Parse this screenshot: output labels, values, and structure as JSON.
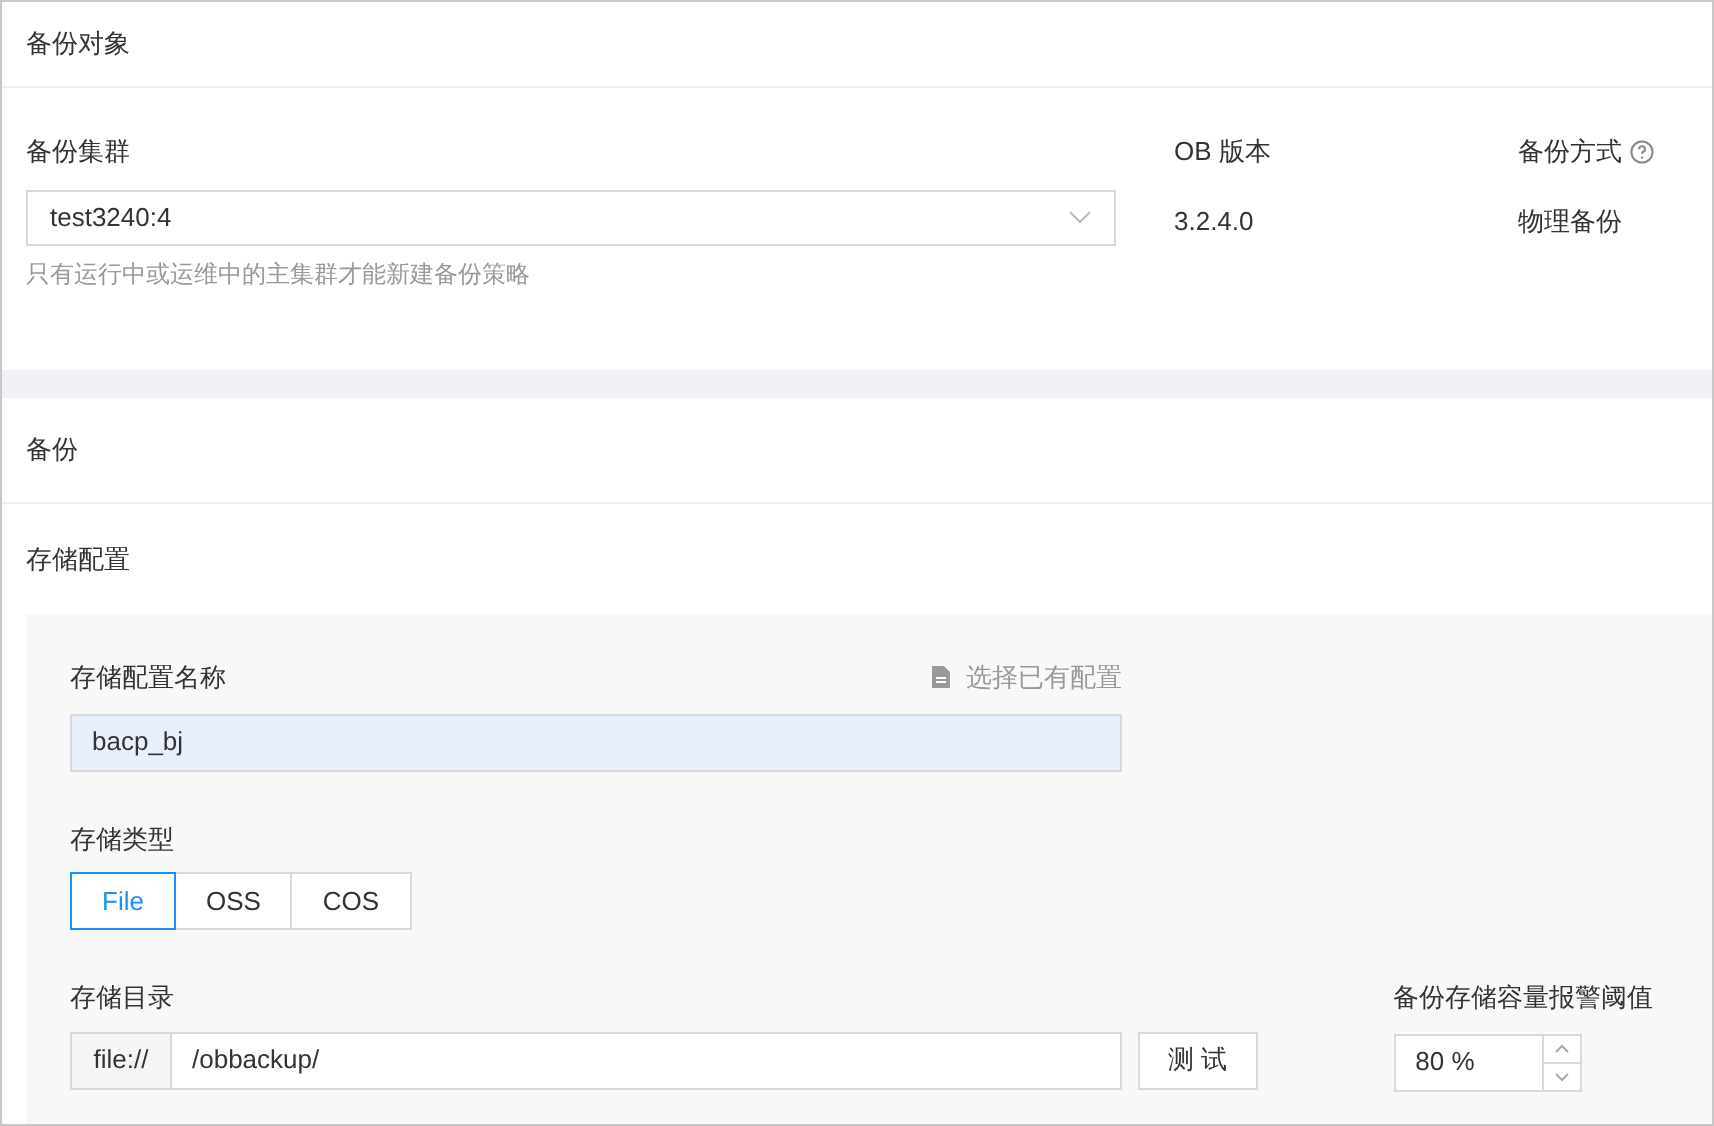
{
  "object_section": {
    "title": "备份对象",
    "cluster": {
      "label": "备份集群",
      "value": "test3240:4",
      "hint": "只有运行中或运维中的主集群才能新建备份策略"
    },
    "version": {
      "label": "OB 版本",
      "value": "3.2.4.0"
    },
    "mode": {
      "label": "备份方式",
      "value": "物理备份"
    }
  },
  "backup_section": {
    "title": "备份",
    "storage_title": "存储配置",
    "config_name": {
      "label": "存储配置名称",
      "value": "bacp_bj",
      "select_existing": "选择已有配置"
    },
    "storage_type": {
      "label": "存储类型",
      "options": [
        {
          "label": "File",
          "selected": true
        },
        {
          "label": "OSS",
          "selected": false
        },
        {
          "label": "COS",
          "selected": false
        }
      ]
    },
    "directory": {
      "label": "存储目录",
      "prefix": "file://",
      "value": "/obbackup/",
      "test_button": "测 试"
    },
    "threshold": {
      "label": "备份存储容量报警阈值",
      "value": "80 %"
    }
  }
}
